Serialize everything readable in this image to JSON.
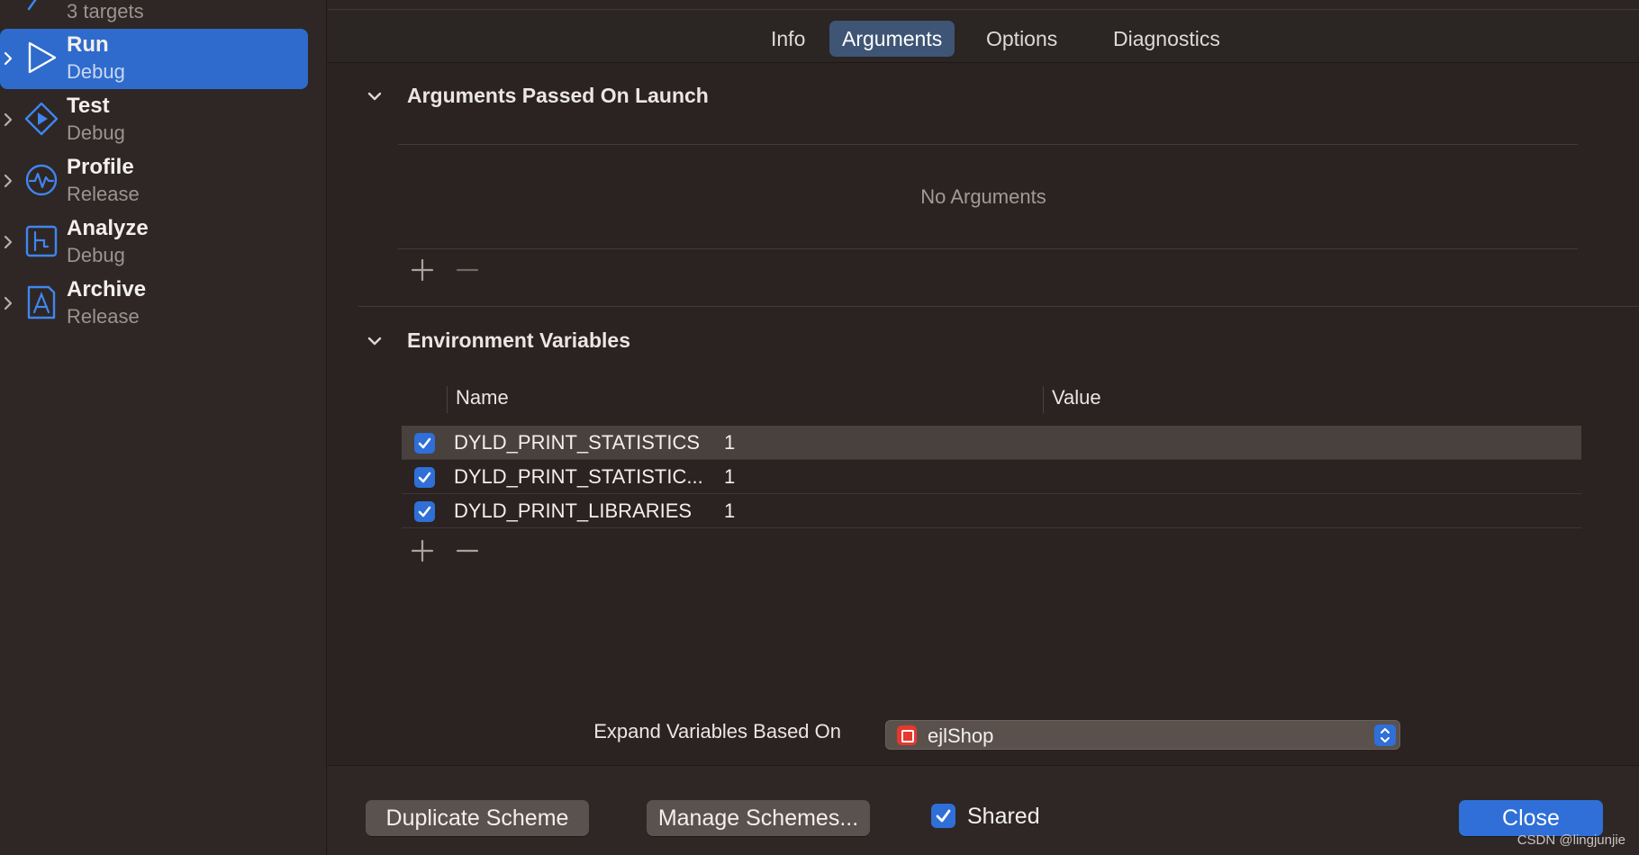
{
  "sidebar": {
    "partial_item": {
      "subtitle": "3 targets"
    },
    "items": [
      {
        "title": "Run",
        "subtitle": "Debug",
        "icon": "run-icon",
        "selected": true
      },
      {
        "title": "Test",
        "subtitle": "Debug",
        "icon": "test-icon",
        "selected": false
      },
      {
        "title": "Profile",
        "subtitle": "Release",
        "icon": "profile-icon",
        "selected": false
      },
      {
        "title": "Analyze",
        "subtitle": "Debug",
        "icon": "analyze-icon",
        "selected": false
      },
      {
        "title": "Archive",
        "subtitle": "Release",
        "icon": "archive-icon",
        "selected": false
      }
    ]
  },
  "tabs": [
    {
      "label": "Info",
      "active": false
    },
    {
      "label": "Arguments",
      "active": true
    },
    {
      "label": "Options",
      "active": false
    },
    {
      "label": "Diagnostics",
      "active": false
    }
  ],
  "arguments_section": {
    "title": "Arguments Passed On Launch",
    "empty_message": "No Arguments"
  },
  "env_section": {
    "title": "Environment Variables",
    "columns": {
      "name": "Name",
      "value": "Value"
    },
    "rows": [
      {
        "name": "DYLD_PRINT_STATISTICS",
        "value": "1",
        "checked": true
      },
      {
        "name": "DYLD_PRINT_STATISTIC...",
        "value": "1",
        "checked": true
      },
      {
        "name": "DYLD_PRINT_LIBRARIES",
        "value": "1",
        "checked": true
      }
    ]
  },
  "expand_variables": {
    "label": "Expand Variables Based On",
    "value": "ejlShop"
  },
  "footer": {
    "duplicate_label": "Duplicate Scheme",
    "manage_label": "Manage Schemes...",
    "shared_label": "Shared",
    "shared_checked": true,
    "close_label": "Close"
  },
  "watermark": "CSDN @lingjunjie",
  "colors": {
    "accent": "#2f6fd7",
    "selected_sidebar": "#2f6bcc",
    "active_tab": "#3e5575",
    "background": "#2b2523"
  }
}
